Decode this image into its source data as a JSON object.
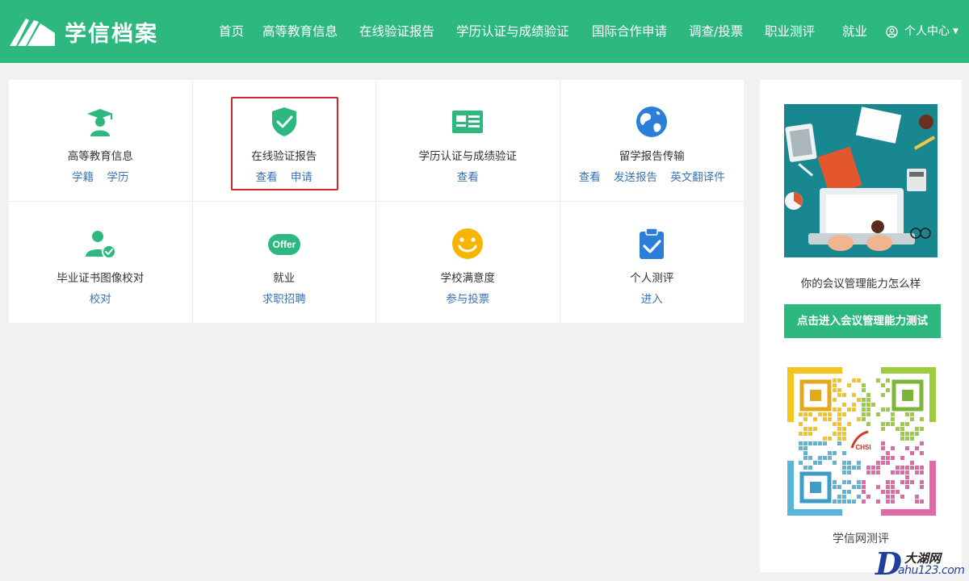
{
  "header": {
    "logo_text": "学信档案",
    "nav": [
      {
        "label": "首页"
      },
      {
        "label": "高等教育信息"
      },
      {
        "label": "在线验证报告"
      },
      {
        "label": "学历认证与成绩验证"
      },
      {
        "label": "国际合作申请"
      },
      {
        "label": "调查/投票"
      },
      {
        "label": "职业测评"
      },
      {
        "label": "就业"
      }
    ],
    "user_menu": "个人中心"
  },
  "services": [
    {
      "title": "高等教育信息",
      "links": [
        "学籍",
        "学历"
      ],
      "icon": "graduate-icon"
    },
    {
      "title": "在线验证报告",
      "links": [
        "查看",
        "申请"
      ],
      "icon": "shield-check-icon"
    },
    {
      "title": "学历认证与成绩验证",
      "links": [
        "查看"
      ],
      "icon": "id-card-icon"
    },
    {
      "title": "留学报告传输",
      "links": [
        "查看",
        "发送报告",
        "英文翻译件"
      ],
      "icon": "globe-icon"
    },
    {
      "title": "毕业证书图像校对",
      "links": [
        "校对"
      ],
      "icon": "user-check-icon"
    },
    {
      "title": "就业",
      "links": [
        "求职招聘"
      ],
      "icon": "offer-icon",
      "badge": "Offer"
    },
    {
      "title": "学校满意度",
      "links": [
        "参与投票"
      ],
      "icon": "smiley-icon"
    },
    {
      "title": "个人测评",
      "links": [
        "进入"
      ],
      "icon": "clipboard-check-icon"
    }
  ],
  "sidebar": {
    "ad_caption": "你的会议管理能力怎么样",
    "ad_button": "点击进入会议管理能力测试",
    "qr_label": "CHSI",
    "qr_caption": "学信网测评"
  },
  "watermark": {
    "letter": "D",
    "name": "大湖网",
    "url": "ahu123.com"
  },
  "colors": {
    "brand": "#2db880",
    "link": "#3b73b4",
    "highlight": "#cc2a2a"
  }
}
